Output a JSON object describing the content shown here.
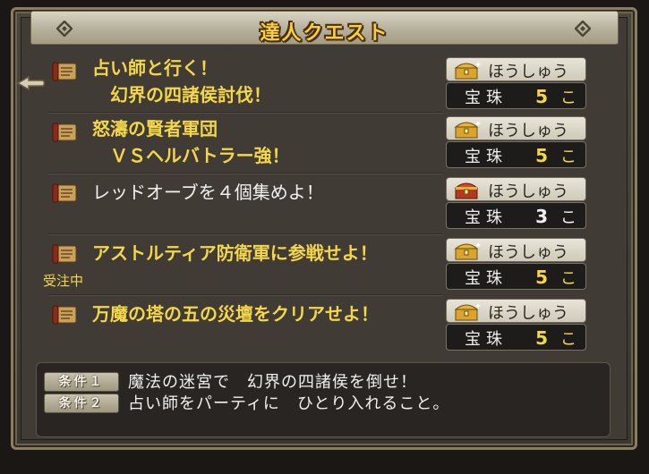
{
  "window": {
    "title": "達人クエスト"
  },
  "quests": [
    {
      "title_lines": [
        "占い師と行く！",
        "　幻界の四諸侯討伐！"
      ],
      "title_color": "gold",
      "reward_label": "ほうしゅう",
      "reward_item": "宝珠",
      "reward_count": "5",
      "reward_unit": "こ",
      "chest": "gold-chest-icon"
    },
    {
      "title_lines": [
        "怒濤の賢者軍団",
        "　ＶＳヘルバトラー強！"
      ],
      "title_color": "gold",
      "reward_label": "ほうしゅう",
      "reward_item": "宝珠",
      "reward_count": "5",
      "reward_unit": "こ",
      "chest": "gold-chest-icon"
    },
    {
      "title_lines": [
        "レッドオーブを４個集めよ！"
      ],
      "title_color": "white",
      "reward_label": "ほうしゅう",
      "reward_item": "宝珠",
      "reward_count": "3",
      "reward_unit": "こ",
      "chest": "red-chest-icon"
    },
    {
      "title_lines": [
        "アストルティア防衛軍に参戦せよ！"
      ],
      "title_color": "gold",
      "status": "受注中",
      "reward_label": "ほうしゅう",
      "reward_item": "宝珠",
      "reward_count": "5",
      "reward_unit": "こ",
      "chest": "gold-chest-icon"
    },
    {
      "title_lines": [
        "万魔の塔の五の災壇をクリアせよ！"
      ],
      "title_color": "gold",
      "reward_label": "ほうしゅう",
      "reward_item": "宝珠",
      "reward_count": "5",
      "reward_unit": "こ",
      "chest": "gold-chest-icon"
    }
  ],
  "conditions": [
    {
      "badge": "条件１",
      "text": "魔法の迷宮で　幻界の四諸侯を倒せ！"
    },
    {
      "badge": "条件２",
      "text": "占い師をパーティに　ひとり入れること。"
    }
  ],
  "colors": {
    "gold_text": "#f3d64a",
    "white_text": "#f1f1f1",
    "panel_bg": "#403b35"
  }
}
